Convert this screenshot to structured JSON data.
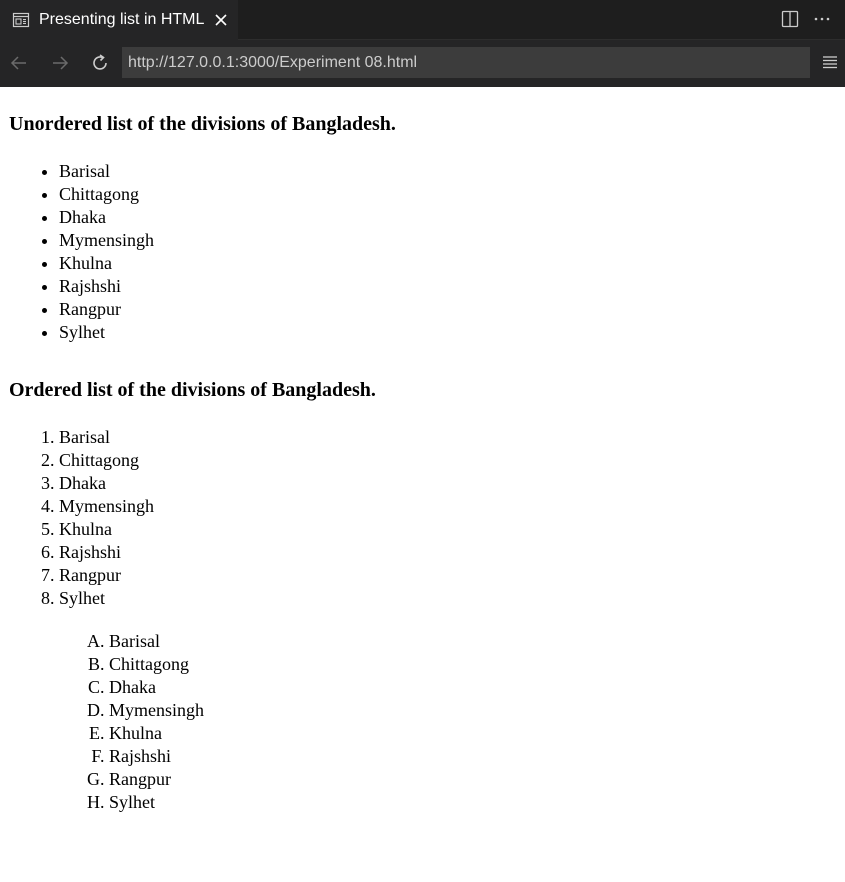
{
  "browser": {
    "tab_title": "Presenting list in HTML",
    "url": "http://127.0.0.1:3000/Experiment 08.html"
  },
  "content": {
    "unordered_heading": "Unordered list of the divisions of Bangladesh.",
    "unordered_items": [
      "Barisal",
      "Chittagong",
      "Dhaka",
      "Mymensingh",
      "Khulna",
      "Rajshshi",
      "Rangpur",
      "Sylhet"
    ],
    "ordered_heading": "Ordered list of the divisions of Bangladesh.",
    "ordered_items": [
      "Barisal",
      "Chittagong",
      "Dhaka",
      "Mymensingh",
      "Khulna",
      "Rajshshi",
      "Rangpur",
      "Sylhet"
    ],
    "alpha_items": [
      "Barisal",
      "Chittagong",
      "Dhaka",
      "Mymensingh",
      "Khulna",
      "Rajshshi",
      "Rangpur",
      "Sylhet"
    ]
  },
  "icons": {
    "tab": "preview-icon",
    "close": "close-icon",
    "split": "split-editor-icon",
    "more": "more-icon",
    "back": "back-arrow-icon",
    "forward": "forward-arrow-icon",
    "reload": "reload-icon",
    "menu": "menu-icon"
  },
  "colors": {
    "chrome_bg": "#252526",
    "tab_strip_bg": "#1e1e1e",
    "url_bg": "#3c3c3c"
  }
}
